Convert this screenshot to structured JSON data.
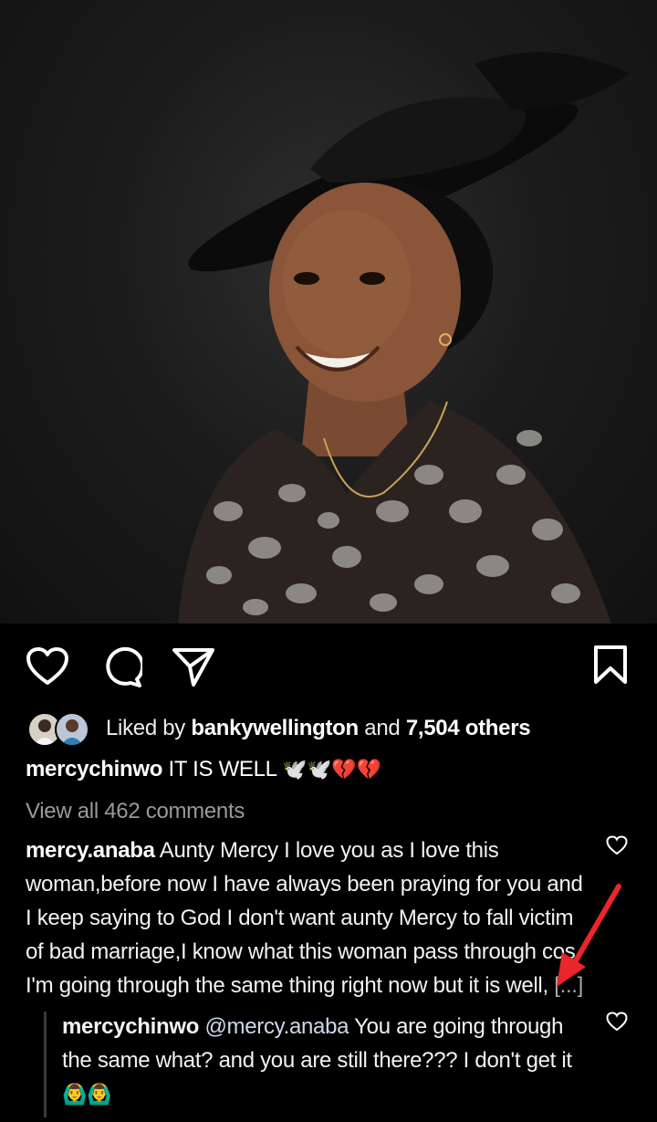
{
  "post": {
    "photo_description_icon": "portrait-photo",
    "likes": {
      "prefix": "Liked by",
      "user": "bankywellington",
      "and": "and",
      "others": "7,504 others"
    },
    "caption": {
      "user": "mercychinwo",
      "text": "IT IS WELL",
      "emojis": "🕊️🕊️💔💔"
    },
    "view_all": "View all 462 comments"
  },
  "comments": [
    {
      "user": "mercy.anaba",
      "text": "Aunty Mercy I love you as I love this woman,before now I have always been praying for you and I keep saying to God I don't want aunty Mercy to fall victim of bad marriage,I know what this woman pass through cos I'm going through the same thing right now but it is well,",
      "more": "[...]"
    }
  ],
  "reply": {
    "user": "mercychinwo",
    "mention": "@mercy.anaba",
    "text": "You are going through the same what? and you are still there??? I don't get it",
    "emojis": "🙆‍♂️🙆‍♂️"
  },
  "colors": {
    "background": "#000000",
    "annotation_arrow": "#e8262c"
  }
}
